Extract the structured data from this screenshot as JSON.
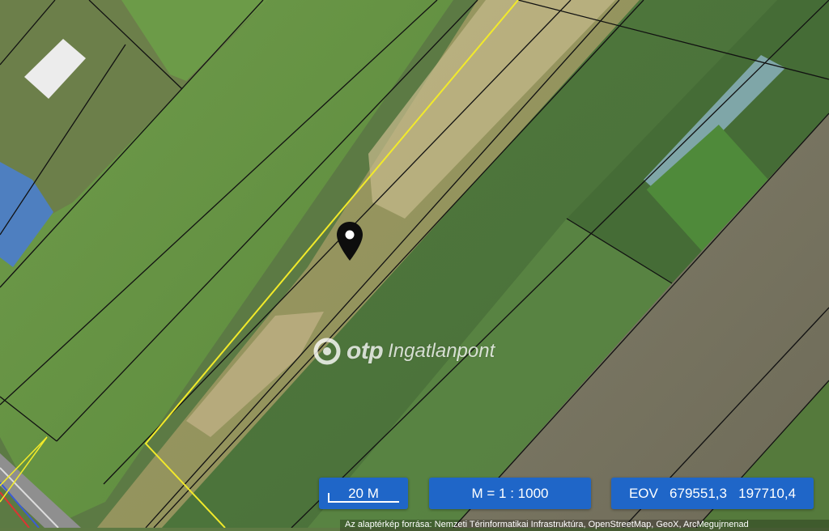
{
  "map": {
    "layer": "satellite-imagery",
    "parcel_line_color": "#111111",
    "highlight_line_color": "#f2ea2a",
    "pin_icon": "map-pin-icon"
  },
  "watermark": {
    "brand": "otp",
    "product": "Ingatlanpont",
    "logo_icon": "otp-logo-icon"
  },
  "scale_bar": {
    "label": "20 M"
  },
  "scale_ratio": {
    "label": "M = 1 : 1000"
  },
  "coordinates": {
    "system": "EOV",
    "x": "679551,3",
    "y": "197710,4"
  },
  "attribution": {
    "text": "Az alaptérkép forrása: Nemzeti Térinformatikai Infrastruktúra, OpenStreetMap, GeoX, ArcMegujrnenad"
  },
  "colors": {
    "control_bg": "#1f66c8",
    "control_text": "#ffffff"
  }
}
